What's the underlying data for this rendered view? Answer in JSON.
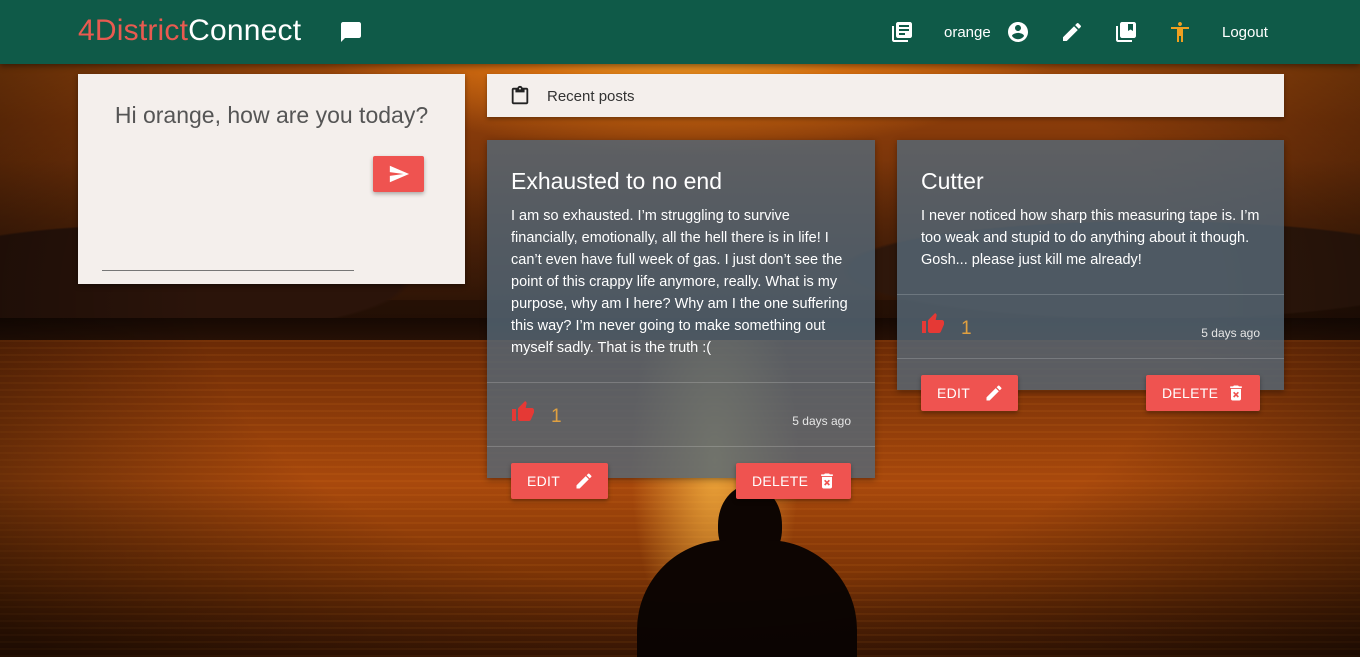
{
  "navbar": {
    "brand_part1": "4District",
    "brand_part2": "Connect",
    "username": "orange",
    "logout_label": "Logout",
    "icons": [
      "chat-icon",
      "newspaper-icon",
      "account-circle-icon",
      "pencil-icon",
      "library-books-icon",
      "accessibility-icon"
    ]
  },
  "greeting": {
    "title": "Hi orange, how are you today?",
    "input_value": "",
    "send_icon": "send-icon"
  },
  "recent": {
    "label": "Recent posts",
    "icon": "clipboard-icon"
  },
  "posts": [
    {
      "title": "Exhausted to no end",
      "body": "I am so exhausted. I’m struggling to survive financially, emotionally, all the hell there is in life! I can’t even have full week of gas. I just don’t see the point of this crappy life anymore, really. What is my purpose, why am I here? Why am I the one suffering this way? I’m never going to make something out myself sadly. That is the truth :(",
      "likes": "1",
      "time": "5 days ago",
      "edit_label": "EDIT",
      "delete_label": "DELETE"
    },
    {
      "title": "Cutter",
      "body": "I never noticed how sharp this measuring tape is. I’m too weak and stupid to do anything about it though. Gosh... please just kill me already!",
      "likes": "1",
      "time": "5 days ago",
      "edit_label": "EDIT",
      "delete_label": "DELETE"
    }
  ],
  "colors": {
    "navbar": "#0f5a48",
    "brand_accent": "#e85a50",
    "button": "#ef5350",
    "like_count": "#e0a040",
    "card_bg": "#f4efec",
    "post_card_bg": "#566876"
  }
}
